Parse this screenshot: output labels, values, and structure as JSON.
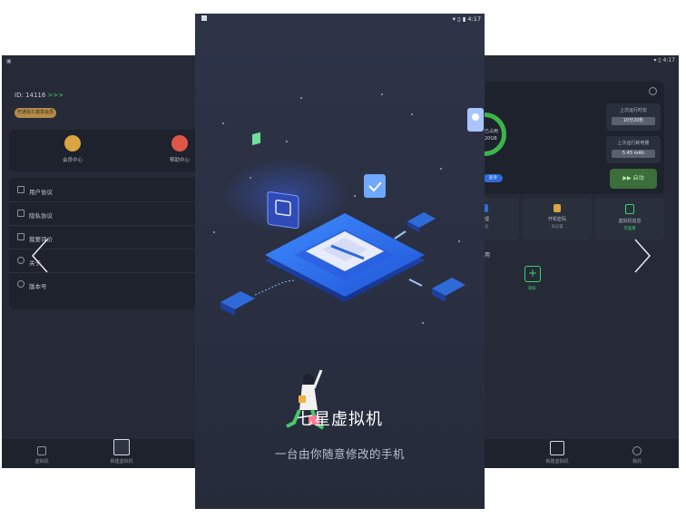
{
  "left_screen": {
    "user_id": "ID: 14116",
    "id_arrow": ">>>",
    "vip_button": "开通永久尊享会员",
    "cards": [
      {
        "label": "会员中心",
        "icon": "crown-icon",
        "color": "#d9a441"
      },
      {
        "label": "帮助中心",
        "icon": "help-icon",
        "color": "#e0574a"
      }
    ],
    "menu": [
      {
        "label": "用户协议",
        "icon": "document-icon"
      },
      {
        "label": "隐私协议",
        "icon": "privacy-icon"
      },
      {
        "label": "我要评价",
        "icon": "comment-icon"
      },
      {
        "label": "关于",
        "icon": "power-icon"
      },
      {
        "label": "版本号",
        "icon": "info-icon"
      }
    ],
    "tabs": [
      "虚拟机",
      "新建虚拟机"
    ]
  },
  "center_screen": {
    "status_time": "4:17",
    "app_title": "七星虚拟机",
    "slogan": "一台由你随意修改的手机"
  },
  "right_screen": {
    "status_time": "4:17",
    "storage_label": "已占用",
    "storage_value": "20GB",
    "storage_button": "查询",
    "last_run_time_label": "上次运行时长",
    "last_run_time": "10分20秒",
    "last_battery_label": "上次运行耗电量",
    "last_battery": "5.45 mAh",
    "start_button": "启动",
    "grid": [
      {
        "label": "清理",
        "sub": "优化",
        "color": "#2f6bd8"
      },
      {
        "label": "开机密码",
        "sub": "未设置",
        "color": "#d9a441"
      },
      {
        "label": "虚拟机信息",
        "sub": "可查看",
        "color": "#3bd16f"
      }
    ],
    "section_label": "用",
    "add_label": "添加",
    "tabs": [
      "新建虚拟机",
      "我的"
    ]
  },
  "colors": {
    "accent_green": "#3bd16f",
    "accent_blue": "#2f6bd8",
    "background": "#2a3042"
  }
}
